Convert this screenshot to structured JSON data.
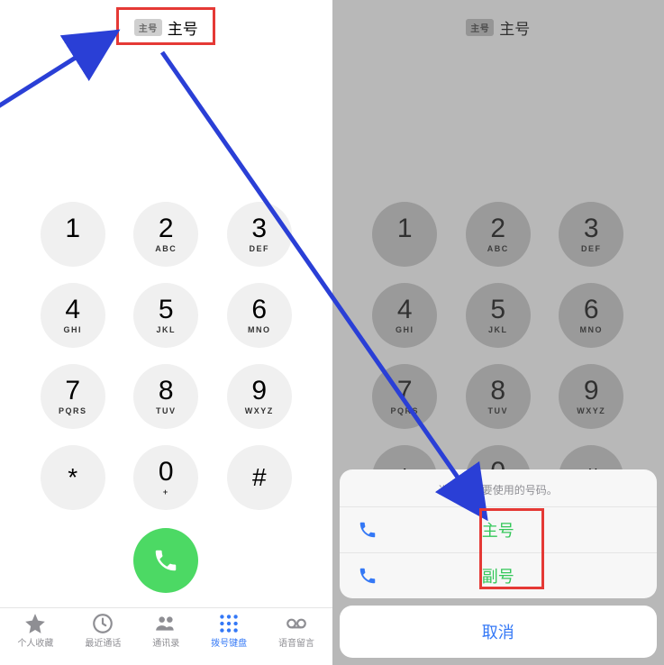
{
  "sim": {
    "badge": "主号",
    "label": "主号"
  },
  "keypad": [
    {
      "digit": "1",
      "letters": ""
    },
    {
      "digit": "2",
      "letters": "ABC"
    },
    {
      "digit": "3",
      "letters": "DEF"
    },
    {
      "digit": "4",
      "letters": "GHI"
    },
    {
      "digit": "5",
      "letters": "JKL"
    },
    {
      "digit": "6",
      "letters": "MNO"
    },
    {
      "digit": "7",
      "letters": "PQRS"
    },
    {
      "digit": "8",
      "letters": "TUV"
    },
    {
      "digit": "9",
      "letters": "WXYZ"
    },
    {
      "digit": "*",
      "letters": ""
    },
    {
      "digit": "0",
      "letters": "+"
    },
    {
      "digit": "#",
      "letters": ""
    }
  ],
  "tabs": [
    {
      "label": "个人收藏",
      "icon": "star",
      "active": false
    },
    {
      "label": "最近通话",
      "icon": "clock",
      "active": false
    },
    {
      "label": "通讯录",
      "icon": "people",
      "active": false
    },
    {
      "label": "拨号键盘",
      "icon": "keypad",
      "active": true
    },
    {
      "label": "语音留言",
      "icon": "voicemail",
      "active": false
    }
  ],
  "sheet": {
    "title": "选择现在要使用的号码。",
    "options": [
      {
        "label": "主号"
      },
      {
        "label": "副号"
      }
    ],
    "cancel": "取消"
  }
}
